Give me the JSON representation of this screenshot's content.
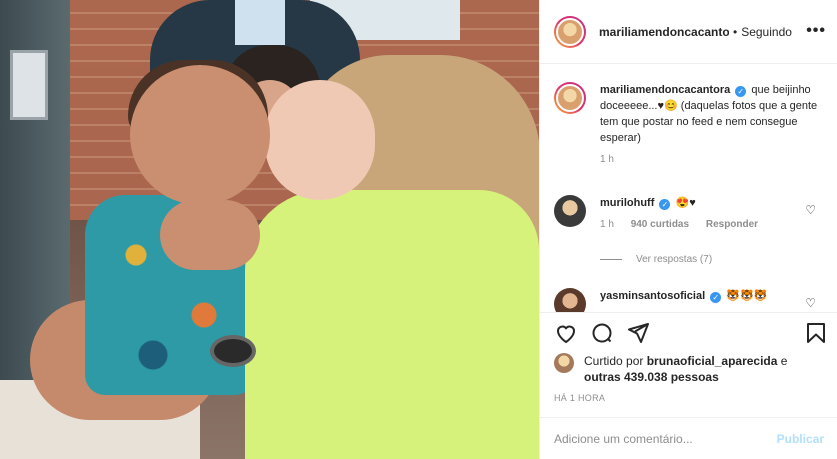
{
  "header": {
    "username": "mariliamendoncacantora",
    "separator": "•",
    "follow_label": "Seguindo",
    "more_icon": "more-horizontal-icon",
    "more_glyph": "•••"
  },
  "caption": {
    "username": "mariliamendoncacantora",
    "text": "que beijinho doceeeee...♥😊 (daquelas fotos que a gente tem que postar no feed e nem consegue esperar)",
    "time": "1 h"
  },
  "comments": [
    {
      "username": "murilohuff",
      "text": "😍♥",
      "time": "1 h",
      "likes": "940 curtidas",
      "reply_label": "Responder",
      "view_replies": "Ver respostas (7)"
    },
    {
      "username": "yasminsantosoficial",
      "text": "🐯🐯🐯"
    }
  ],
  "likes": {
    "prefix": "Curtido por",
    "user": "brunaoficial_aparecida",
    "suffix": "e",
    "others": "outras 439.038 pessoas"
  },
  "timestamp": "HÁ 1 HORA",
  "add_comment": {
    "placeholder": "Adicione um comentário...",
    "post_label": "Publicar"
  },
  "colors": {
    "verified": "#3897f0",
    "post_disabled": "#b2dffc",
    "muted": "#8e8e8e"
  }
}
